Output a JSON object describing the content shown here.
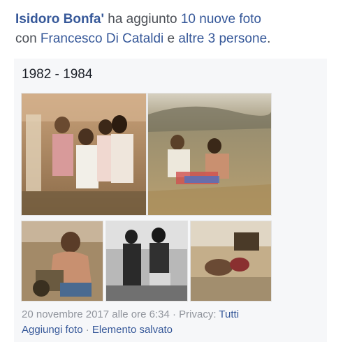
{
  "post": {
    "author": "Isidoro Bonfa'",
    "action_text": " ha aggiunto ",
    "photos_link": "10 nuove foto",
    "with_text": "con ",
    "tagged_person": "Francesco Di Cataldi",
    "and_text": " e ",
    "others_link": "altre 3 persone",
    "end_punct": "."
  },
  "album": {
    "title": "1982 - 1984",
    "photos": [
      {
        "name": "photo-group-children",
        "icon": "photo",
        "tone": "#b98c60"
      },
      {
        "name": "photo-field-repair",
        "icon": "photo",
        "tone": "#b2a272"
      },
      {
        "name": "photo-man-shirtless",
        "icon": "photo",
        "tone": "#8e7658"
      },
      {
        "name": "photo-black-white-group",
        "icon": "photo",
        "tone": "#8c8c8c"
      },
      {
        "name": "photo-rest-on-ground",
        "icon": "photo",
        "tone": "#a8926e"
      }
    ]
  },
  "footer": {
    "timestamp": "20 novembre 2017 alle ore 6:34",
    "separator": " · ",
    "privacy_label": "Privacy: ",
    "privacy_value": "Tutti",
    "add_photo": "Aggiungi foto",
    "saved_item": "Elemento salvato"
  },
  "colors": {
    "link": "#365899",
    "meta": "#90949c",
    "text": "#1d2129"
  }
}
